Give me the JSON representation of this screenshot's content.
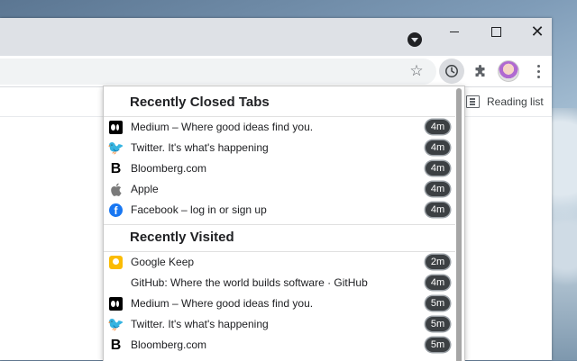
{
  "browser": {
    "reading_list_label": "Reading list"
  },
  "history_menu": {
    "recently_closed_title": "Recently Closed Tabs",
    "recently_visited_title": "Recently Visited",
    "recently_closed": [
      {
        "icon": "medium-icon",
        "label": "Medium – Where good ideas find you.",
        "time": "4m"
      },
      {
        "icon": "twitter-icon",
        "label": "Twitter. It's what's happening",
        "time": "4m"
      },
      {
        "icon": "bloomberg-icon",
        "label": "Bloomberg.com",
        "time": "4m"
      },
      {
        "icon": "apple-icon",
        "label": "Apple",
        "time": "4m"
      },
      {
        "icon": "facebook-icon",
        "label": "Facebook – log in or sign up",
        "time": "4m"
      }
    ],
    "recently_visited": [
      {
        "icon": "google-keep-icon",
        "label": "Google Keep",
        "time": "2m"
      },
      {
        "icon": "github-icon",
        "label": "GitHub: Where the world builds software · GitHub",
        "time": "4m"
      },
      {
        "icon": "medium-icon",
        "label": "Medium – Where good ideas find you.",
        "time": "5m"
      },
      {
        "icon": "twitter-icon",
        "label": "Twitter. It's what's happening",
        "time": "5m"
      },
      {
        "icon": "bloomberg-icon",
        "label": "Bloomberg.com",
        "time": "5m"
      }
    ]
  }
}
